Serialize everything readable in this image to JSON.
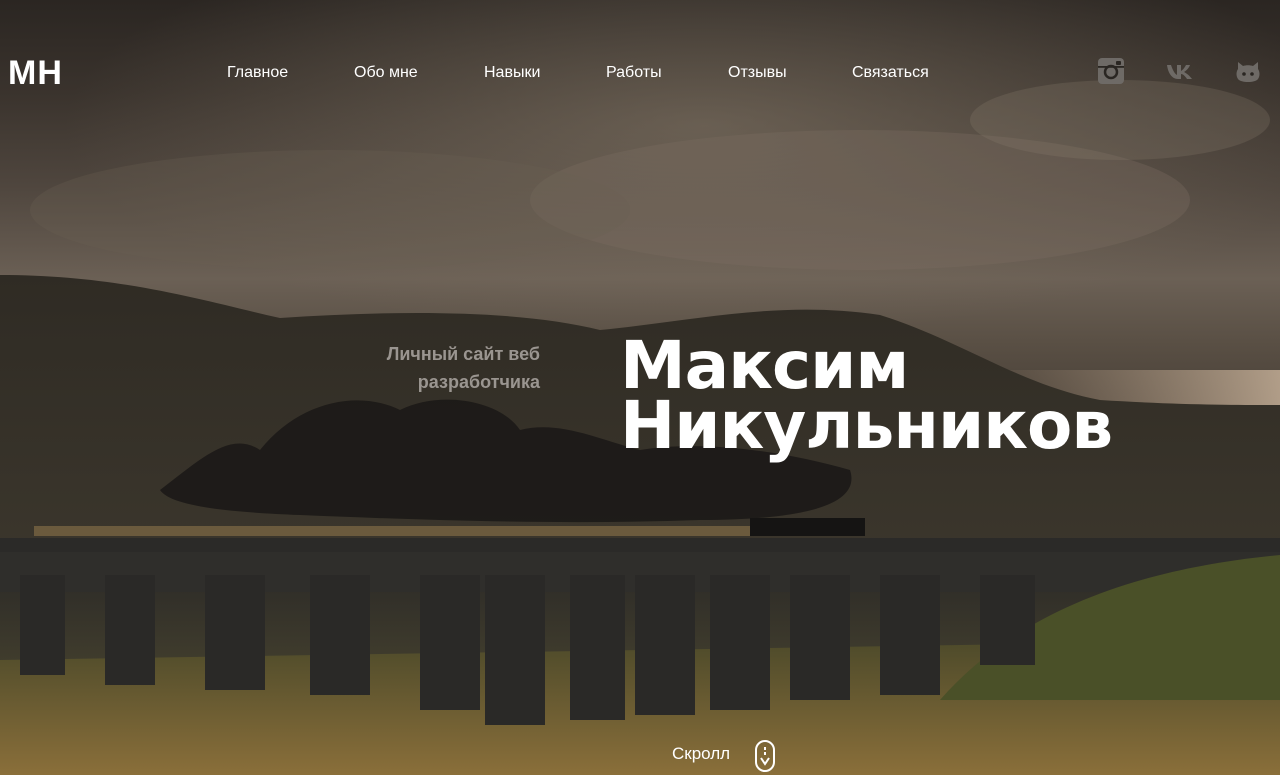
{
  "header": {
    "logo": "МН",
    "nav": [
      {
        "label": "Главное"
      },
      {
        "label": "Обо мне"
      },
      {
        "label": "Навыки"
      },
      {
        "label": "Работы"
      },
      {
        "label": "Отзывы"
      },
      {
        "label": "Связаться"
      }
    ],
    "social": [
      {
        "icon": "instagram-icon"
      },
      {
        "icon": "vk-icon"
      },
      {
        "icon": "github-icon"
      }
    ]
  },
  "hero": {
    "subtitle_line1": "Личный сайт веб",
    "subtitle_line2": "разработчика",
    "name_line1": "Максим",
    "name_line2": "Никульников",
    "scroll_label": "Скролл"
  },
  "colors": {
    "text": "#ffffff",
    "subtitle": "#9a9590",
    "icon": "#6e6a66"
  }
}
